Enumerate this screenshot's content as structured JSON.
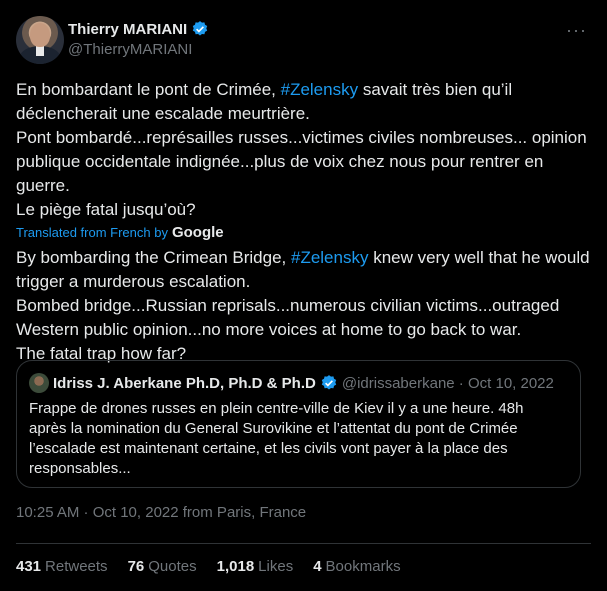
{
  "author": {
    "display_name": "Thierry MARIANI",
    "handle": "@ThierryMARIANI"
  },
  "more_menu_icon": "more-horizontal-icon",
  "tweet_original": {
    "line1_pre": "En bombardant le pont de Crimée, ",
    "line1_hashtag": "#Zelensky",
    "line1_post": " savait très bien qu’il déclencherait une escalade meurtrière.",
    "line2": "Pont bombardé...représailles russes...victimes civiles nombreuses... opinion publique occidentale indignée...plus de voix chez nous pour rentrer en guerre.",
    "line3": "Le piège fatal jusqu’où?"
  },
  "translation_label": "Translated from French by",
  "translation_provider": "Google",
  "tweet_translation": {
    "line1_pre": "By bombarding the Crimean Bridge, ",
    "line1_hashtag": "#Zelensky",
    "line1_post": " knew very well that he would trigger a murderous escalation.",
    "line2": "Bombed bridge...Russian reprisals...numerous civilian victims...outraged Western public opinion...no more voices at home to go back to war.",
    "line3": "The fatal trap how far?"
  },
  "quoted_tweet": {
    "display_name": "Idriss J. Aberkane Ph.D, Ph.D & Ph.D",
    "handle_date": "@idrissaberkane · Oct 10, 2022",
    "text": "Frappe de drones russes en plein centre-ville de Kiev il y a une heure. 48h après la nomination du General Surovikine et l’attentat du pont de Crimée l’escalade est maintenant certaine, et les civils vont payer à la place des responsables..."
  },
  "timestamp": "10:25 AM · Oct 10, 2022 from Paris, France",
  "stats": [
    {
      "count": "431",
      "label": "Retweets"
    },
    {
      "count": "76",
      "label": "Quotes"
    },
    {
      "count": "1,018",
      "label": "Likes"
    },
    {
      "count": "4",
      "label": "Bookmarks"
    }
  ],
  "colors": {
    "background": "#000000",
    "text": "#e7e9ea",
    "secondary": "#71767b",
    "accent": "#1d9bf0",
    "border": "#2f3336"
  }
}
